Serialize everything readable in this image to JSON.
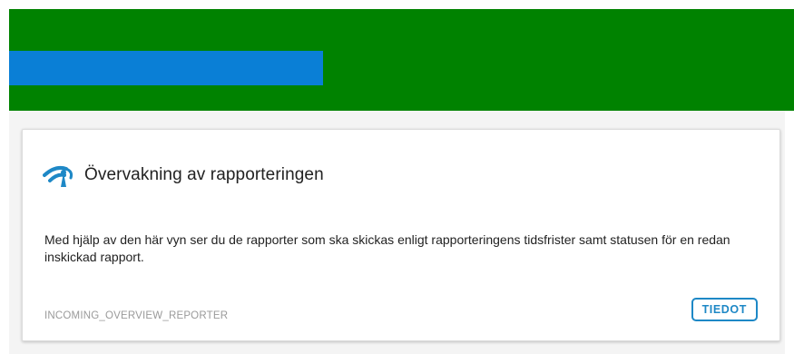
{
  "card": {
    "title": "Övervakning av rapporteringen",
    "icon": "signal-antenna-icon",
    "description": "Med hjälp av den här vyn ser du de rapporter som ska skickas enligt rapporteringens tidsfrister samt statusen för en redan inskickad rapport.",
    "code": "INCOMING_OVERVIEW_REPORTER",
    "details_button_label": "TIEDOT"
  },
  "colors": {
    "banner": "#008200",
    "banner_bar": "#0a7fd6",
    "accent": "#1e88c6",
    "icon": "#1e88c6",
    "content_background": "#f4f4f4"
  }
}
